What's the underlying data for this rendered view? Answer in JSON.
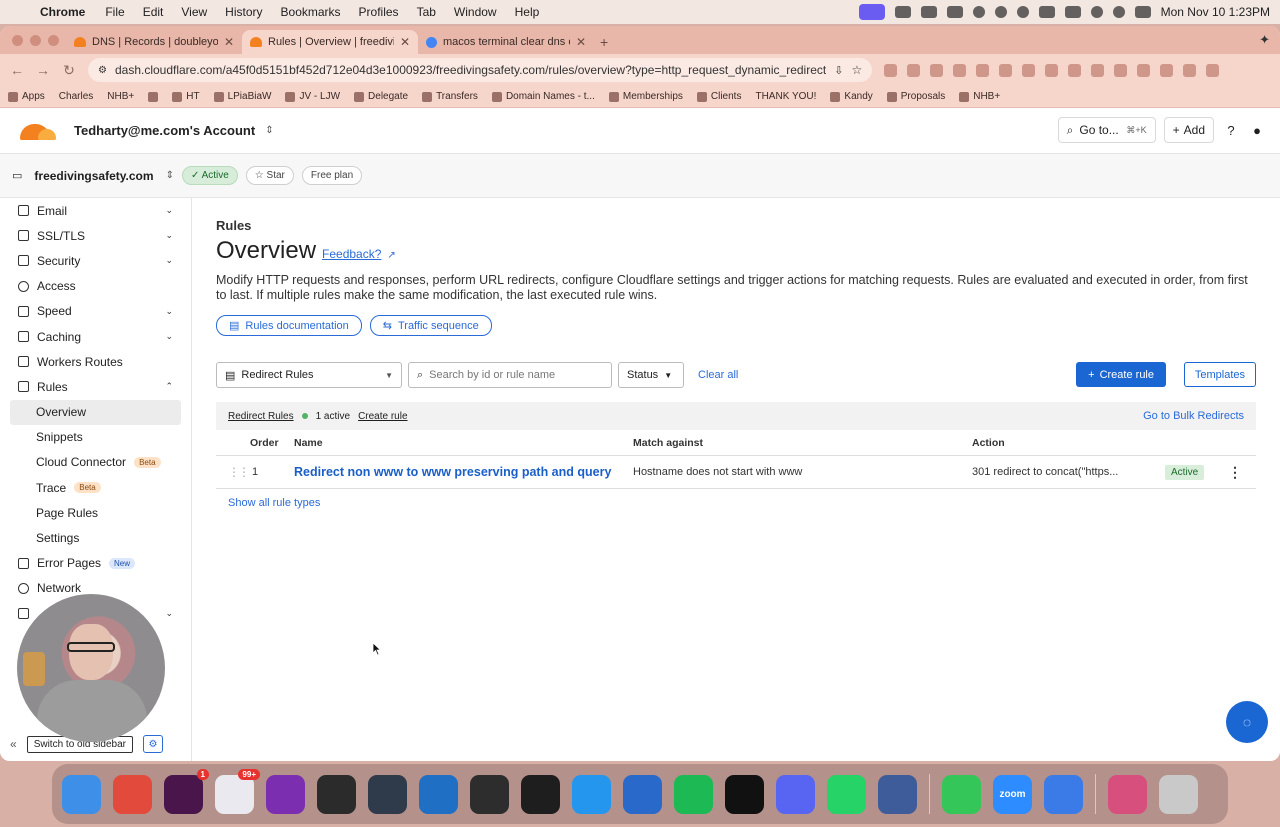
{
  "menubar": {
    "app": "Chrome",
    "menus": [
      "File",
      "Edit",
      "View",
      "History",
      "Bookmarks",
      "Profiles",
      "Tab",
      "Window",
      "Help"
    ],
    "datetime": "Mon Nov 10  1:23PM"
  },
  "tabs": [
    {
      "title": "DNS | Records | doubleyourb",
      "active": false
    },
    {
      "title": "Rules | Overview | freedivings",
      "active": true
    },
    {
      "title": "macos terminal clear dns cac",
      "active": false
    }
  ],
  "omnibox": {
    "url": "dash.cloudflare.com/a45f0d5151bf452d712e04d3e1000923/freedivingsafety.com/rules/overview?type=http_request_dynamic_redirect"
  },
  "bookmarks": [
    "Apps",
    "Charles",
    "NHB+",
    "",
    "HT",
    "LPiaBiaW",
    "JV - LJW",
    "Delegate",
    "Transfers",
    "Domain Names - t...",
    "Memberships",
    "Clients",
    "THANK YOU!",
    "Kandy",
    "Proposals",
    "NHB+"
  ],
  "header": {
    "account": "Tedharty@me.com's Account",
    "goto": "Go to...",
    "goto_kbd": "⌘+K",
    "add": "Add"
  },
  "zone": {
    "domain": "freedivingsafety.com",
    "status": "Active",
    "star": "Star",
    "plan": "Free plan"
  },
  "sidebar": {
    "items": [
      {
        "label": "Email",
        "caret": "⌄"
      },
      {
        "label": "SSL/TLS",
        "caret": "⌄"
      },
      {
        "label": "Security",
        "caret": "⌄"
      },
      {
        "label": "Access",
        "caret": ""
      },
      {
        "label": "Speed",
        "caret": "⌄"
      },
      {
        "label": "Caching",
        "caret": "⌄"
      },
      {
        "label": "Workers Routes",
        "caret": ""
      },
      {
        "label": "Rules",
        "caret": "⌃"
      }
    ],
    "rules_sub": [
      {
        "label": "Overview",
        "badge": ""
      },
      {
        "label": "Snippets",
        "badge": ""
      },
      {
        "label": "Cloud Connector",
        "badge": "Beta"
      },
      {
        "label": "Trace",
        "badge": "Beta"
      },
      {
        "label": "Page Rules",
        "badge": ""
      },
      {
        "label": "Settings",
        "badge": ""
      }
    ],
    "after": [
      {
        "label": "Error Pages",
        "badge": "New"
      },
      {
        "label": "Network",
        "badge": ""
      }
    ],
    "switch_label": "Switch to old sidebar"
  },
  "main": {
    "crumb": "Rules",
    "title": "Overview",
    "feedback": "Feedback?",
    "description": "Modify HTTP requests and responses, perform URL redirects, configure Cloudflare settings and trigger actions for matching requests. Rules are evaluated and executed in order, from first to last. If multiple rules make the same modification, the last executed rule wins.",
    "docs_btn": "Rules documentation",
    "traffic_btn": "Traffic sequence",
    "filter_select": "Redirect Rules",
    "search_placeholder": "Search by id or rule name",
    "status_filter": "Status",
    "clear_all": "Clear all",
    "create_rule": "Create rule",
    "templates": "Templates",
    "table_section": "Redirect Rules",
    "active_count": "1 active",
    "create_rule_link": "Create rule",
    "bulk_link": "Go to Bulk Redirects",
    "columns": {
      "order": "Order",
      "name": "Name",
      "match": "Match against",
      "action": "Action"
    },
    "rows": [
      {
        "order": "1",
        "name": "Redirect non www to www preserving path and query",
        "match": "Hostname does not start with www",
        "action": "301 redirect to concat(\"https...",
        "status": "Active"
      }
    ],
    "show_all": "Show all rule types"
  },
  "dock": [
    {
      "name": "Finder",
      "color": "#3d8fe8"
    },
    {
      "name": "Chrome",
      "color": "#e24a3b"
    },
    {
      "name": "Slack",
      "color": "#4a154b",
      "badge": "1"
    },
    {
      "name": "Tasks",
      "color": "#e9e9ef",
      "badge": "99+"
    },
    {
      "name": "OneNote",
      "color": "#7b2fb0"
    },
    {
      "name": "ChatGPT",
      "color": "#2b2b2b"
    },
    {
      "name": "Telegram",
      "color": "#2f3a4a"
    },
    {
      "name": "VS Code",
      "color": "#1f6fc4"
    },
    {
      "name": "GitHub",
      "color": "#2d2d2d"
    },
    {
      "name": "Terminal",
      "color": "#1e1e1e"
    },
    {
      "name": "Docker",
      "color": "#2496ed"
    },
    {
      "name": "Screens",
      "color": "#2869c9"
    },
    {
      "name": "Spotify",
      "color": "#1db954"
    },
    {
      "name": "CapCut",
      "color": "#111"
    },
    {
      "name": "Discord",
      "color": "#5865f2"
    },
    {
      "name": "WhatsApp",
      "color": "#25d366"
    },
    {
      "name": "Simulator",
      "color": "#3f5c9a"
    },
    {
      "name": "Messages",
      "color": "#35c659"
    },
    {
      "name": "Zoom",
      "color": "#2d8cff",
      "label": "zoom"
    },
    {
      "name": "Settings",
      "color": "#3b7be8"
    },
    {
      "name": "Preview",
      "color": "#d64f7d"
    },
    {
      "name": "Trash",
      "color": "#c9c9c9"
    }
  ],
  "colors": {
    "accent": "#1a66d2",
    "active_green": "#d7ecd9",
    "cf_orange": "#f48120"
  }
}
